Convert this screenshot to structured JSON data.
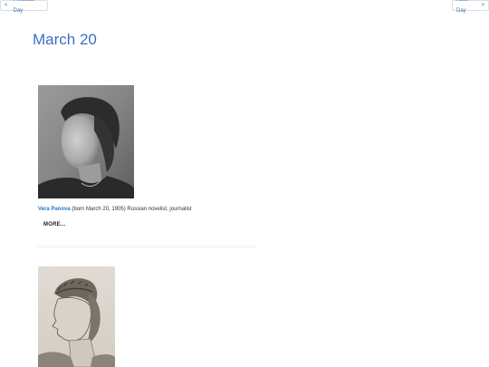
{
  "nav": {
    "prev_icon": "chevron-left-icon",
    "prev_chevron": "<",
    "prev_label": "Previous Day",
    "next_label": "Next Day",
    "next_chevron": ">",
    "next_icon": "chevron-right-icon"
  },
  "page": {
    "title": "March 20"
  },
  "entries": [
    {
      "name": "Vera Panova",
      "description": "(born March 20, 1905) Russian novelist, journalist",
      "more_label": "MORE..."
    },
    {
      "name": "",
      "description": "",
      "more_label": ""
    }
  ],
  "colors": {
    "accent": "#3a70c9",
    "link": "#2a73c9"
  }
}
